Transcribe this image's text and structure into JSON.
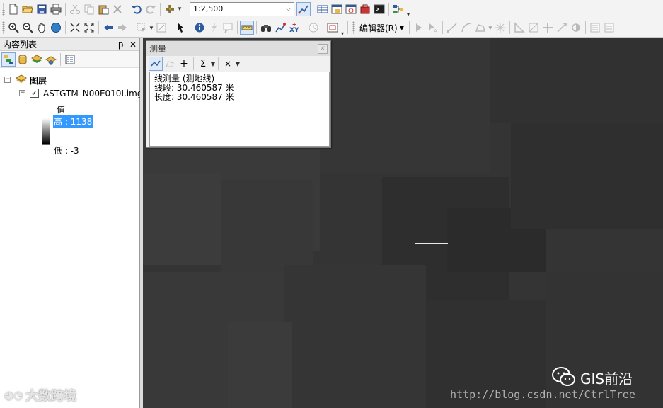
{
  "toolbar1": {
    "scale_value": "1:2,500",
    "icons": [
      "new-icon",
      "open-icon",
      "save-icon",
      "print-icon",
      "cut-icon",
      "copy-icon",
      "paste-icon",
      "delete-icon",
      "undo-icon",
      "redo-icon",
      "add-data-icon",
      "scale-combo",
      "editor-toolbar-icon",
      "table-icon",
      "catalog-icon",
      "search-window-icon",
      "arctoolbox-icon",
      "python-icon",
      "model-builder-icon"
    ]
  },
  "toolbar2": {
    "editor_label": "编辑器(R)"
  },
  "toc": {
    "title": "内容列表",
    "pin": "ᵽ",
    "close": "✕",
    "layers_root": "图层",
    "layer_name": "ASTGTM_N00E010I.img",
    "legend_heading": "值",
    "high_label": "高 : 1138",
    "low_label": "低 : -3",
    "tools": [
      "list-by-drawing-order-icon",
      "list-by-source-icon",
      "list-by-visibility-icon",
      "list-by-selection-icon",
      "options-icon"
    ]
  },
  "measure": {
    "title": "测量",
    "close": "×",
    "tool_sigma": "Σ",
    "tool_clear": "×",
    "tool_point": "+",
    "result_line1": "线测量 (测地线)",
    "result_line2": "线段: 30.460587 米",
    "result_line3": "长度: 30.460587 米"
  },
  "watermarks": {
    "left": "大数跨境",
    "brand": "GIS前沿",
    "url": "http://blog.csdn.net/CtrlTree"
  },
  "colors": {
    "map_background": "#343434",
    "selection_highlight": "#3399ff",
    "measure_line": "#e8e8e8"
  }
}
